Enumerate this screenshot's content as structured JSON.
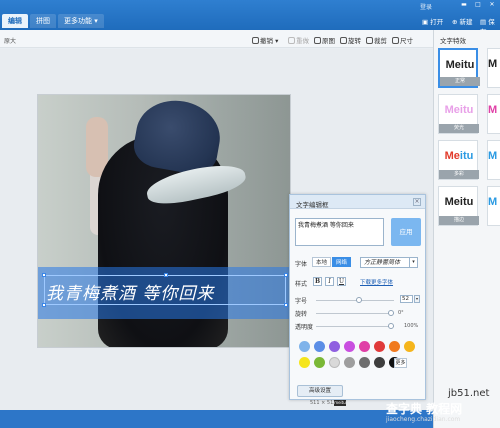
{
  "topbar": {
    "tabs": [
      {
        "label": "编辑"
      },
      {
        "label": "拼图"
      },
      {
        "label": "更多功能 ▾"
      }
    ],
    "login": "登录",
    "open": "打开",
    "new": "新建",
    "save": "保存"
  },
  "toolbar": {
    "zoom": "原大",
    "undo": "撤销 ▾",
    "redo": "重做",
    "original": "原图",
    "rotate": "旋转",
    "crop": "裁剪",
    "size": "尺寸"
  },
  "canvas": {
    "overlay_text": "我青梅煮酒 等你回来",
    "size_info": "511 × 512",
    "brand_tag": "meitu"
  },
  "right_panel": {
    "title": "文字特效",
    "effects": [
      {
        "logo": "Meitu",
        "label": "正常",
        "color": "#222222"
      },
      {
        "logo": "Meitu",
        "label": "荧光",
        "color": "#e8a0e8"
      },
      {
        "logo": "Meitu",
        "label": "多彩",
        "color": "#e23a2a"
      },
      {
        "logo": "Meitu",
        "label": "描边",
        "color": "#222222"
      }
    ],
    "partial_logo": "M"
  },
  "dialog": {
    "title": "文字编辑框",
    "close": "×",
    "text_value": "我青梅煮酒  等你回来",
    "apply": "应用",
    "font_label": "字体",
    "font_tab_local": "本地",
    "font_tab_online": "网络",
    "font_name": "方正静蕾简体",
    "style_label": "样式",
    "bold": "B",
    "italic": "I",
    "underline": "U",
    "download_more": "下载更多字体",
    "size_label": "字号",
    "size_value": "52",
    "rotate_label": "旋转",
    "rotate_value": "0°",
    "opacity_label": "透明度",
    "opacity_value": "100%",
    "more": "更多",
    "advanced": "高级设置",
    "colors": [
      "#7fb3ea",
      "#5b8ee6",
      "#8f5fe0",
      "#c94fe0",
      "#e03fa6",
      "#e03a3a",
      "#f07a1e",
      "#f5b51c",
      "#f5e51c",
      "#7ab836",
      "#d9d9d9",
      "#9e9e9e",
      "#6e6e6e",
      "#3e3e3e",
      "#111111"
    ]
  },
  "watermark": {
    "line1": "jb51.net",
    "line2": "查字典 教程网",
    "line3": "jiaocheng.chazidian.com"
  }
}
